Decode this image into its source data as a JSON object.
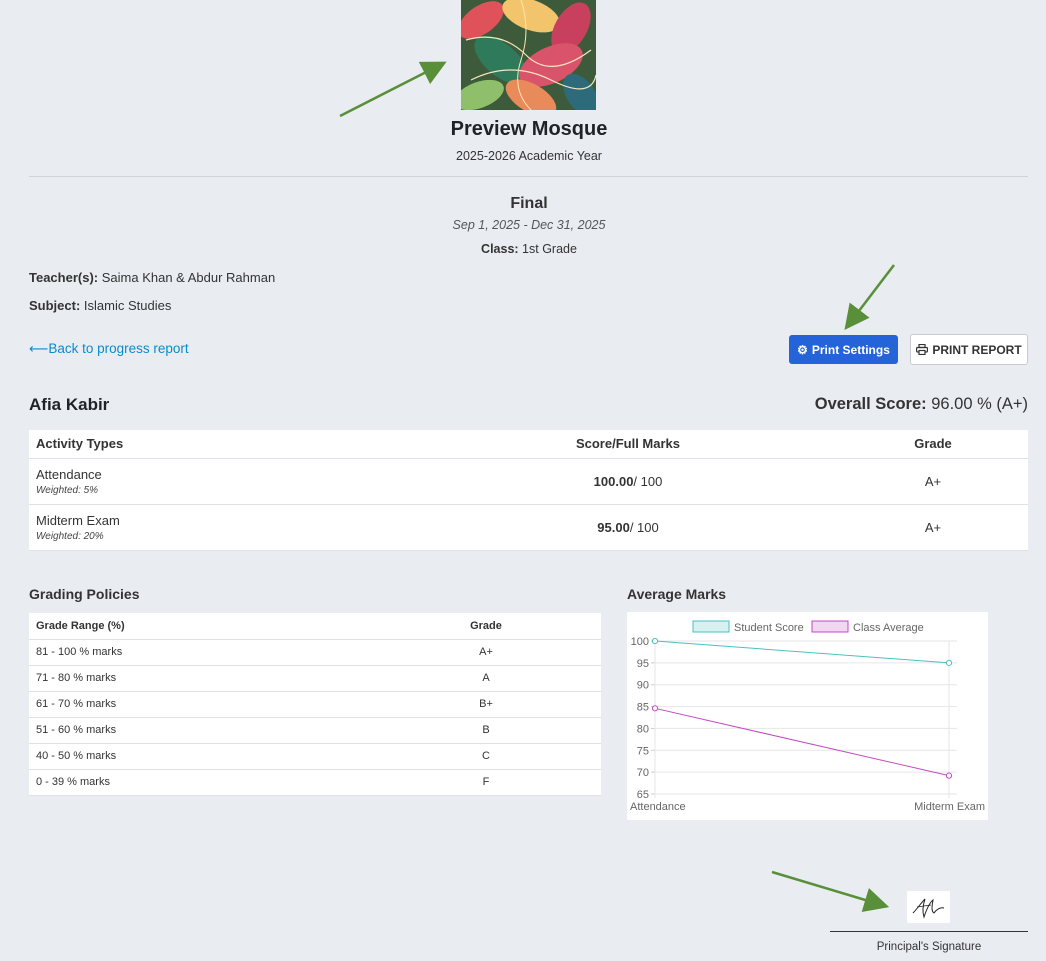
{
  "school": {
    "name": "Preview Mosque",
    "academic_year": "2025-2026 Academic Year"
  },
  "term": {
    "name": "Final",
    "dates": "Sep 1, 2025 - Dec 31, 2025",
    "class_label": "Class:",
    "class_value": " 1st Grade"
  },
  "info": {
    "teacher_label": "Teacher(s):",
    "teacher_value": " Saima Khan & Abdur Rahman",
    "subject_label": "Subject:",
    "subject_value": " Islamic Studies"
  },
  "nav": {
    "back_label": "Back to progress report",
    "back_icon": "arrow-left-icon"
  },
  "actions": {
    "print_settings_label": "Print Settings",
    "print_settings_icon": "gear-icon",
    "print_report_label": "PRINT REPORT",
    "print_report_icon": "printer-icon",
    "primary_color": "#2563d9"
  },
  "student": {
    "name": "Afia Kabir",
    "overall_label": "Overall Score:",
    "overall_value": " 96.00 % (A+)"
  },
  "activity_table": {
    "headers": [
      "Activity Types",
      "Score/Full Marks",
      "Grade"
    ],
    "rows": [
      {
        "activity": "Attendance",
        "weight": "Weighted: 5%",
        "score": "100.00",
        "full": "/ 100",
        "grade": "A+"
      },
      {
        "activity": "Midterm Exam",
        "weight": "Weighted: 20%",
        "score": "95.00",
        "full": "/ 100",
        "grade": "A+"
      }
    ]
  },
  "grading_policies": {
    "title": "Grading Policies",
    "headers": [
      "Grade Range (%)",
      "Grade"
    ],
    "rows": [
      {
        "range": "81 - 100 % marks",
        "grade": "A+"
      },
      {
        "range": "71 - 80 % marks",
        "grade": "A"
      },
      {
        "range": "61 - 70 % marks",
        "grade": "B+"
      },
      {
        "range": "51 - 60 % marks",
        "grade": "B"
      },
      {
        "range": "40 - 50 % marks",
        "grade": "C"
      },
      {
        "range": "0 - 39 % marks",
        "grade": "F"
      }
    ]
  },
  "average_marks": {
    "title": "Average Marks"
  },
  "chart_data": {
    "type": "line",
    "categories": [
      "Attendance",
      "Midterm Exam"
    ],
    "series": [
      {
        "name": "Student Score",
        "values": [
          100,
          95
        ],
        "color": "#4bc0c0"
      },
      {
        "name": "Class Average",
        "values": [
          84.6,
          69.2
        ],
        "color": "#c04bc0"
      }
    ],
    "ylim": [
      65,
      100
    ],
    "yticks": [
      65,
      70,
      75,
      80,
      85,
      90,
      95,
      100
    ],
    "grid": true,
    "legend": "top"
  },
  "signature": {
    "label": "Principal's Signature"
  },
  "annotation_color": "#5a8f3a"
}
